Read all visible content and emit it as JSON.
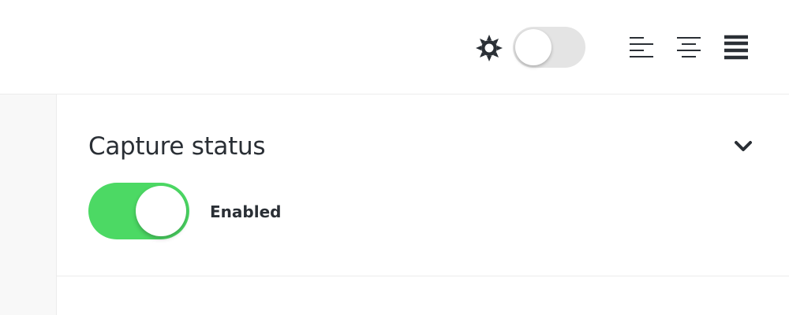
{
  "toolbar": {
    "theme_icon": "sun-icon",
    "theme_toggle": {
      "state": "off"
    },
    "alignment": [
      {
        "icon": "align-left-icon"
      },
      {
        "icon": "align-center-icon"
      },
      {
        "icon": "align-justify-icon"
      }
    ],
    "selected_alignment": "justify"
  },
  "panel": {
    "title": "Capture status",
    "collapse_icon": "chevron-down-icon",
    "toggle": {
      "state": "on",
      "color": "#4cd964"
    },
    "status_label": "Enabled"
  },
  "colors": {
    "accent_green": "#4cd964",
    "text": "#2a2f35",
    "toggle_off": "#e4e4e4"
  }
}
